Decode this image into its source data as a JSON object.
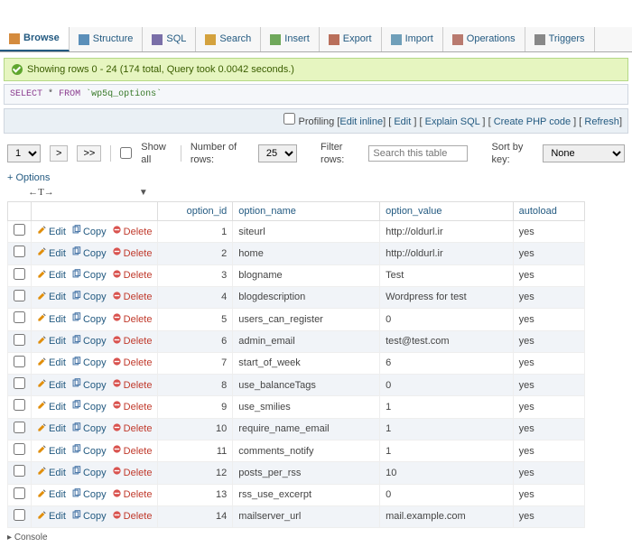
{
  "tabs": [
    "Browse",
    "Structure",
    "SQL",
    "Search",
    "Insert",
    "Export",
    "Import",
    "Operations",
    "Triggers"
  ],
  "activeTab": 0,
  "message": "Showing rows 0 - 24 (174 total, Query took 0.0042 seconds.)",
  "sql": {
    "select": "SELECT",
    "star": "*",
    "from": "FROM",
    "table": "`wp5q_options`"
  },
  "toolbar": {
    "profiling": "Profiling",
    "editInline": "Edit inline",
    "edit": "Edit",
    "explain": "Explain SQL",
    "php": "Create PHP code",
    "refresh": "Refresh"
  },
  "nav": {
    "page": "1",
    "next": ">",
    "last": ">>",
    "showAll": "Show all",
    "numRowsLabel": "Number of rows:",
    "numRows": "25",
    "filterLabel": "Filter rows:",
    "filterPlaceholder": "Search this table",
    "sortLabel": "Sort by key:",
    "sortValue": "None"
  },
  "optionsLink": "+ Options",
  "cols": [
    "option_id",
    "option_name",
    "option_value",
    "autoload"
  ],
  "actions": {
    "edit": "Edit",
    "copy": "Copy",
    "delete": "Delete"
  },
  "rows": [
    {
      "id": "1",
      "name": "siteurl",
      "value": "http://oldurl.ir",
      "autoload": "yes"
    },
    {
      "id": "2",
      "name": "home",
      "value": "http://oldurl.ir",
      "autoload": "yes"
    },
    {
      "id": "3",
      "name": "blogname",
      "value": "Test",
      "autoload": "yes"
    },
    {
      "id": "4",
      "name": "blogdescription",
      "value": "Wordpress for test",
      "autoload": "yes"
    },
    {
      "id": "5",
      "name": "users_can_register",
      "value": "0",
      "autoload": "yes"
    },
    {
      "id": "6",
      "name": "admin_email",
      "value": "test@test.com",
      "autoload": "yes"
    },
    {
      "id": "7",
      "name": "start_of_week",
      "value": "6",
      "autoload": "yes"
    },
    {
      "id": "8",
      "name": "use_balanceTags",
      "value": "0",
      "autoload": "yes"
    },
    {
      "id": "9",
      "name": "use_smilies",
      "value": "1",
      "autoload": "yes"
    },
    {
      "id": "10",
      "name": "require_name_email",
      "value": "1",
      "autoload": "yes"
    },
    {
      "id": "11",
      "name": "comments_notify",
      "value": "1",
      "autoload": "yes"
    },
    {
      "id": "12",
      "name": "posts_per_rss",
      "value": "10",
      "autoload": "yes"
    },
    {
      "id": "13",
      "name": "rss_use_excerpt",
      "value": "0",
      "autoload": "yes"
    },
    {
      "id": "14",
      "name": "mailserver_url",
      "value": "mail.example.com",
      "autoload": "yes"
    }
  ],
  "console": "Console"
}
